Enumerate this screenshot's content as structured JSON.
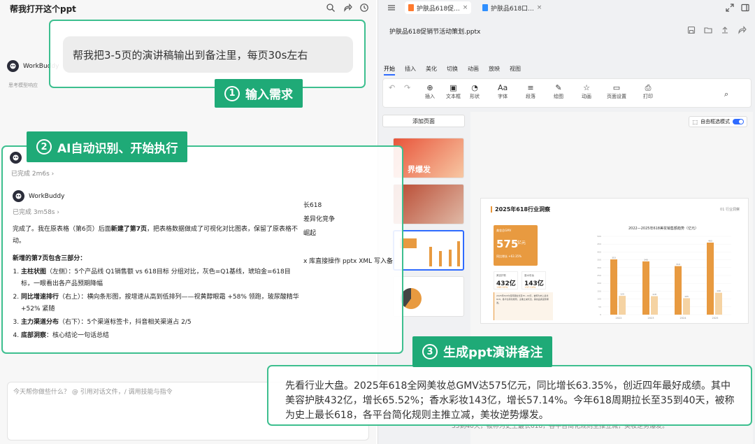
{
  "chat": {
    "title": "帮我打开这个ppt",
    "agent_name": "WorkBuddy",
    "agent_sub": "思考模型响应",
    "input_placeholder": "今天帮你做些什么？ @ 引用对话文件，/ 调用技能与指令"
  },
  "callout1": {
    "request": "帮我把3-5页的演讲稿输出到备注里，每页30s左右",
    "badge_num": "1",
    "badge_label": "输入需求"
  },
  "callout2": {
    "badge_num": "2",
    "badge_label": "AI自动识别、开始执行",
    "done1": "已完成 2m6s",
    "agent_name": "WorkBuddy",
    "done2": "已完成 3m58s",
    "intro_a": "完成了。我在原表格（第6页）后面",
    "intro_b": "新建了第7页",
    "intro_c": "，把表格数据做成了可视化对比图表，保留了原表格不动。",
    "section": "新增的第7页包含三部分：",
    "items": [
      {
        "h": "主柱状图",
        "t": "（左侧）：5个产品线 Q1销售额 vs 618目标 分组对比，灰色=Q1基线，琥珀金=618目标，一眼看出各产品预期降幅"
      },
      {
        "h": "同比增速排行",
        "t": "（右上）：横向条形图，按增速从高到低排列——视黄醇眼霜 +58% 领跑，玻尿酸精华 +52% 紧随"
      },
      {
        "h": "主力渠道分布",
        "t": "（右下）：5个渠道标签卡，抖音相关渠道占 2/5"
      },
      {
        "h": "底部洞察",
        "t": "：核心结论一句话总结"
      }
    ],
    "side_lines": [
      "长618",
      "差异化竞争",
      "崛起",
      "",
      "x 库直接操作 pptx XML 写入备"
    ]
  },
  "callout3": {
    "badge_num": "3",
    "badge_label": "生成ppt演讲备注",
    "note": "先看行业大盘。2025年618全网美妆总GMV达575亿元，同比增长63.35%，创近四年最好成绩。其中美容护肤432亿，增长65.52%；香水彩妆143亿，增长57.14%。今年618周期拉长至35到40天，被称为史上最长618，各平台简化规则主推立减，美妆逆势爆发。",
    "under": "35到40天，被称为史上最长618，各平台简化规则主推立减，美妆逆势爆发。"
  },
  "ppt": {
    "tab1": "护肤品618促...",
    "tab2": "护肤品618口...",
    "doc_title": "护肤品618促销节活动策划.pptx",
    "menu": [
      "开始",
      "插入",
      "美化",
      "切换",
      "动画",
      "放映",
      "视图"
    ],
    "tools": [
      "插入",
      "文本框",
      "形状",
      "字体",
      "段落",
      "绘图",
      "动画",
      "页面设置",
      "打印"
    ],
    "add_page": "添加页面",
    "free_mode": "自由框选模式",
    "thumb_text": "界爆发"
  },
  "slide": {
    "title": "2025年618行业洞察",
    "index": "01 行业洞察",
    "big_label": "美妆总GMV",
    "big_value": "575",
    "big_unit": "亿元",
    "big_yoy": "同比增长 +63.35%",
    "card1_label": "美容护肤",
    "card1_value": "432亿",
    "card1_growth": "+65.52%",
    "card2_label": "香水彩妆",
    "card2_value": "143亿",
    "card2_growth": "+57.14%",
    "note": "2025年618大促周期拉长至35~40天，被称为史上最长618，各平台简化规则，主推立减玩法，美妆品类逆势爆发。"
  },
  "chart_data": {
    "type": "bar",
    "title": "2022—2025年618美妆销售额趋势（亿元）",
    "categories": [
      "2022",
      "2023",
      "2024",
      "2025"
    ],
    "series": [
      {
        "name": "",
        "values": [
          353,
          340,
          310,
          460
        ],
        "color": "#e89a40"
      },
      {
        "name": "",
        "values": [
          120,
          118,
          105,
          140
        ],
        "color": "#f5d3a3"
      }
    ],
    "ylim": [
      0,
      500
    ]
  }
}
